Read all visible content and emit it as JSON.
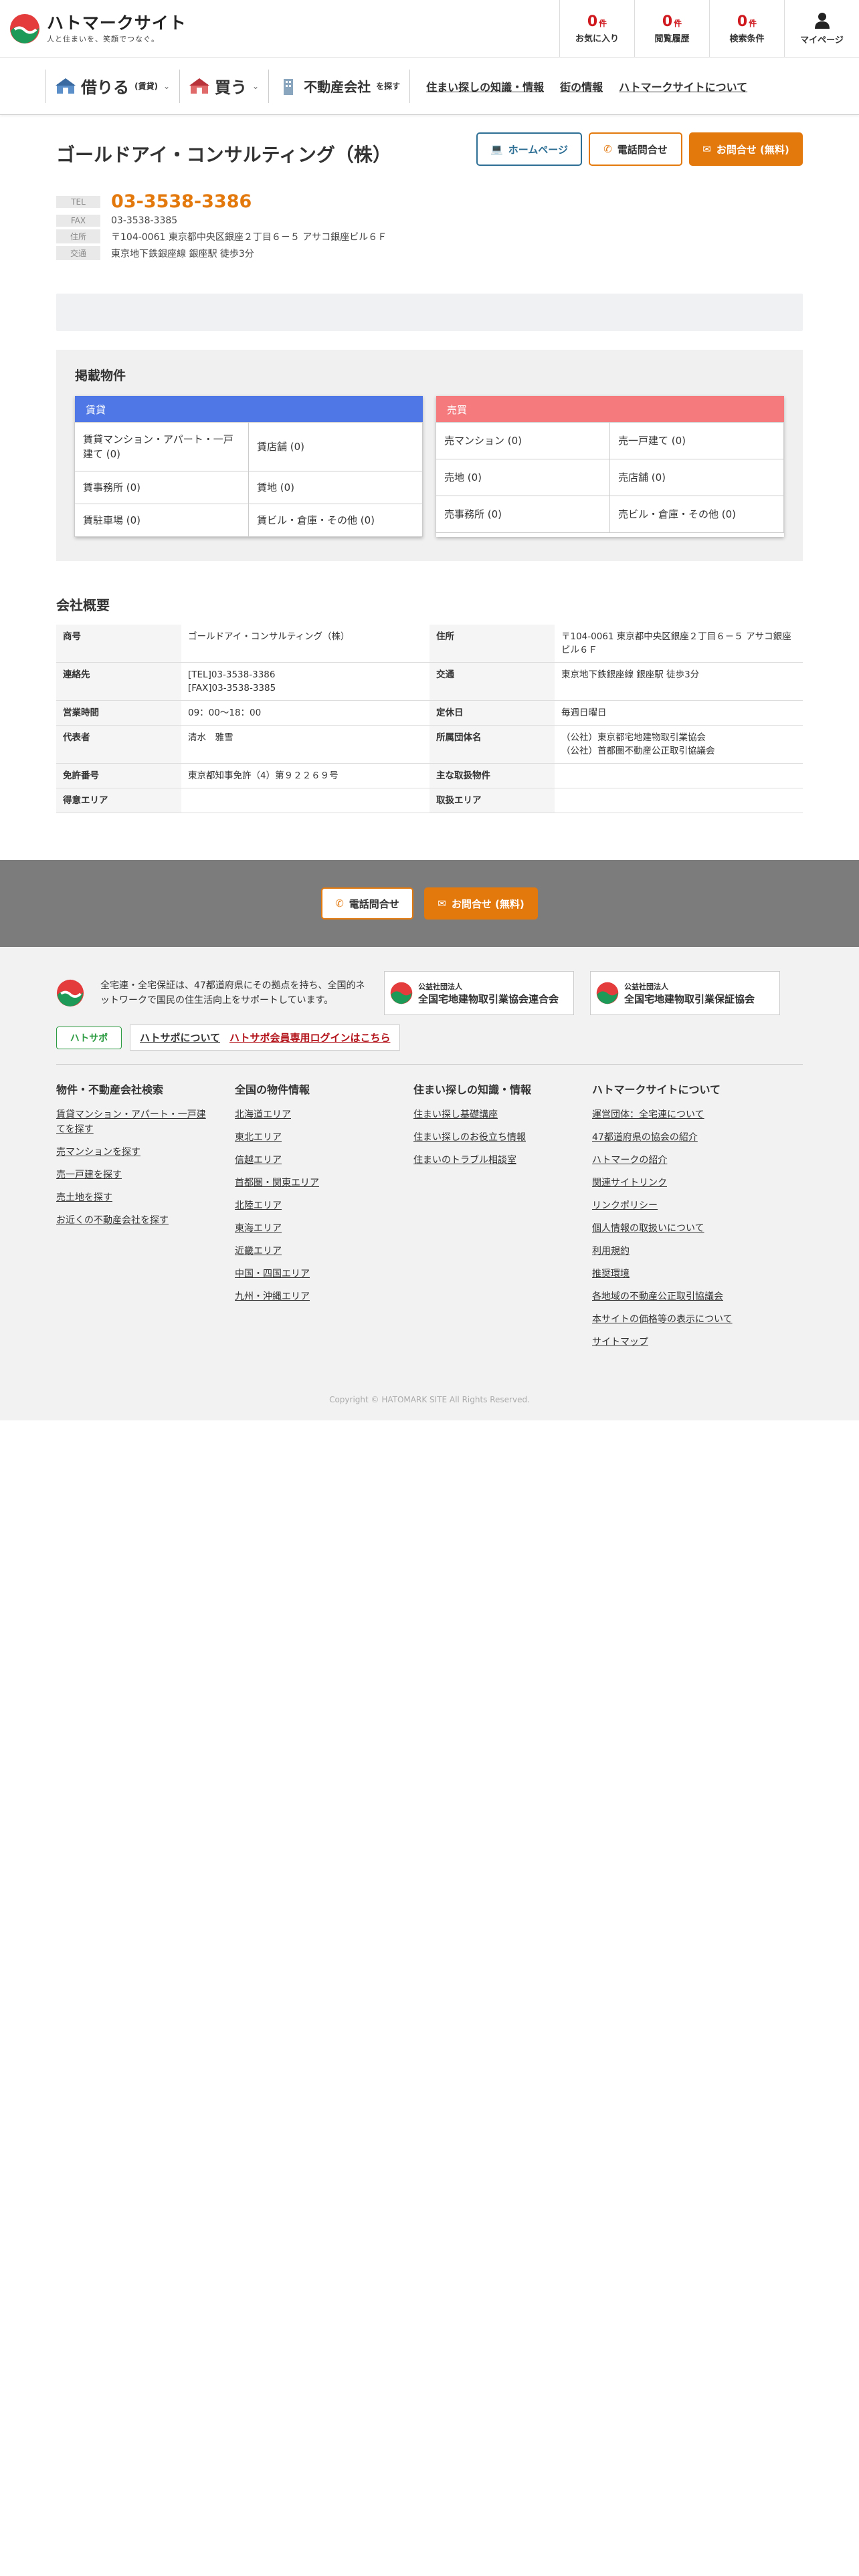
{
  "header": {
    "logo_title": "ハトマークサイト",
    "logo_tagline": "人と住まいを、笑顔でつなぐ。",
    "counts": [
      {
        "num": "0",
        "unit": "件",
        "label": "お気に入り"
      },
      {
        "num": "0",
        "unit": "件",
        "label": "閲覧履歴"
      },
      {
        "num": "0",
        "unit": "件",
        "label": "検索条件"
      }
    ],
    "mypage": "マイページ"
  },
  "nav": {
    "rent": {
      "label": "借りる",
      "sub": "(賃貸)"
    },
    "buy": {
      "label": "買う"
    },
    "agent": {
      "label": "不動産会社",
      "sub": "を探す"
    },
    "links": [
      "住まい探しの知識・情報",
      "街の情報",
      "ハトマークサイトについて"
    ]
  },
  "company": {
    "name": "ゴールドアイ・コンサルティング（株）",
    "buttons": {
      "home": "ホームページ",
      "tel": "電話問合せ",
      "contact": "お問合せ (無料)"
    },
    "info": [
      {
        "label": "TEL",
        "value": "03-3538-3386"
      },
      {
        "label": "FAX",
        "value": "03-3538-3385"
      },
      {
        "label": "住所",
        "value": "〒104-0061 東京都中央区銀座２丁目６－５ アサコ銀座ビル６Ｆ"
      },
      {
        "label": "交通",
        "value": "東京地下鉄銀座線 銀座駅 徒歩3分"
      }
    ]
  },
  "listing": {
    "title": "掲載物件",
    "rent": {
      "head": "賃貸",
      "items": [
        "賃貸マンション・アパート・一戸建て (0)",
        "賃店舗 (0)",
        "賃事務所 (0)",
        "賃地 (0)",
        "賃駐車場 (0)",
        "賃ビル・倉庫・その他 (0)"
      ]
    },
    "sale": {
      "head": "売買",
      "items": [
        "売マンション (0)",
        "売一戸建て (0)",
        "売地 (0)",
        "売店舗 (0)",
        "売事務所 (0)",
        "売ビル・倉庫・その他 (0)"
      ]
    }
  },
  "overview": {
    "title": "会社概要",
    "rows": [
      [
        {
          "k": "商号",
          "v": "ゴールドアイ・コンサルティング（株）"
        },
        {
          "k": "住所",
          "v": "〒104-0061 東京都中央区銀座２丁目６－５ アサコ銀座ビル６Ｆ"
        }
      ],
      [
        {
          "k": "連絡先",
          "v": "[TEL]03-3538-3386\n[FAX]03-3538-3385"
        },
        {
          "k": "交通",
          "v": "東京地下鉄銀座線 銀座駅 徒歩3分"
        }
      ],
      [
        {
          "k": "営業時間",
          "v": "09：00〜18：00"
        },
        {
          "k": "定休日",
          "v": "毎週日曜日"
        }
      ],
      [
        {
          "k": "代表者",
          "v": "清水　雅雪"
        },
        {
          "k": "所属団体名",
          "v": "（公社）東京都宅地建物取引業協会\n（公社）首都圏不動産公正取引協議会"
        }
      ],
      [
        {
          "k": "免許番号",
          "v": "東京都知事免許（4）第９２２６９号"
        },
        {
          "k": "主な取扱物件",
          "v": ""
        }
      ],
      [
        {
          "k": "得意エリア",
          "v": ""
        },
        {
          "k": "取扱エリア",
          "v": ""
        }
      ]
    ]
  },
  "bottom_actions": {
    "tel": "電話問合せ",
    "contact": "お問合せ (無料)"
  },
  "footer": {
    "desc": "全宅連・全宅保証は、47都道府県にその拠点を持ち、全国的ネットワークで国民の住生活向上をサポートしています。",
    "assoc1": {
      "t1": "公益社団法人",
      "t2": "全国宅地建物取引業協会連合会"
    },
    "assoc2": {
      "t1": "公益社団法人",
      "t2": "全国宅地建物取引業保証協会"
    },
    "hatosapo_logo": "ハトサポ",
    "hatosapo_about": "ハトサポについて",
    "hatosapo_login": "ハトサポ会員専用ログインはこちら",
    "cols": [
      {
        "title": "物件・不動産会社検索",
        "links": [
          "賃貸マンション・アパート・一戸建てを探す",
          "売マンションを探す",
          "売一戸建を探す",
          "売土地を探す",
          "お近くの不動産会社を探す"
        ]
      },
      {
        "title": "全国の物件情報",
        "links": [
          "北海道エリア",
          "東北エリア",
          "信越エリア",
          "首都圏・関東エリア",
          "北陸エリア",
          "東海エリア",
          "近畿エリア",
          "中国・四国エリア",
          "九州・沖縄エリア"
        ]
      },
      {
        "title": "住まい探しの知識・情報",
        "links": [
          "住まい探し基礎講座",
          "住まい探しのお役立ち情報",
          "住まいのトラブル相談室"
        ]
      },
      {
        "title": "ハトマークサイトについて",
        "links": [
          "運営団体：全宅連について",
          "47都道府県の協会の紹介",
          "ハトマークの紹介",
          "関連サイトリンク",
          "リンクポリシー",
          "個人情報の取扱いについて",
          "利用規約",
          "推奨環境",
          "各地域の不動産公正取引協議会",
          "本サイトの価格等の表示について",
          "サイトマップ"
        ]
      }
    ],
    "copyright": "Copyright © HATOMARK SITE All Rights Reserved."
  }
}
